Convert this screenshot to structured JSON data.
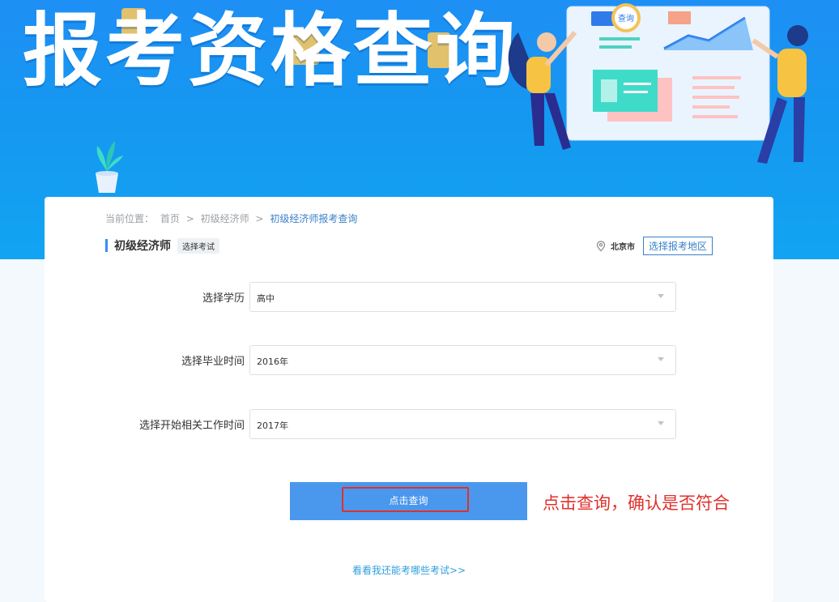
{
  "banner": {
    "title": "报考资格查询",
    "illustration_badge": "查询"
  },
  "breadcrumb": {
    "prefix": "当前位置：",
    "home": "首页",
    "sep1": ">",
    "level1": "初级经济师",
    "sep2": ">",
    "current": "初级经济师报考查询"
  },
  "section": {
    "title": "初级经济师",
    "exam_select": "选择考试"
  },
  "region": {
    "city": "北京市",
    "select_button": "选择报考地区"
  },
  "form": {
    "education": {
      "label": "选择学历",
      "value": "高中"
    },
    "graduation": {
      "label": "选择毕业时间",
      "value": "2016年"
    },
    "work_start": {
      "label": "选择开始相关工作时间",
      "value": "2017年"
    }
  },
  "query_button": "点击查询",
  "annotation": "点击查询，确认是否符合",
  "more_link": "看看我还能考哪些考试>>",
  "colors": {
    "banner": "#1e8ff5",
    "primary_button": "#4a97ee",
    "link": "#3a80c8",
    "annotation": "#e0312b"
  }
}
